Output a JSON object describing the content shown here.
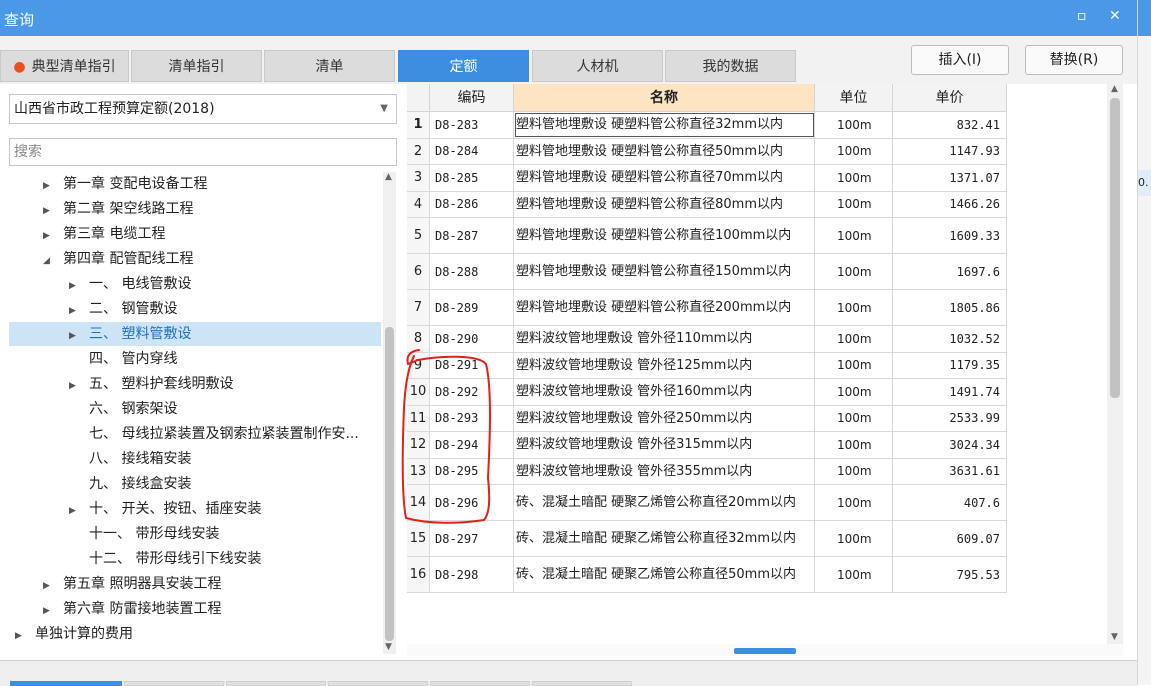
{
  "window": {
    "title": "查询",
    "minimize_glyph": "▫",
    "close_glyph": "✕"
  },
  "tabs": [
    {
      "label": "典型清单指引",
      "icon": "fire-icon"
    },
    {
      "label": "清单指引"
    },
    {
      "label": "清单"
    },
    {
      "label": "定额",
      "active": true
    },
    {
      "label": "人材机"
    },
    {
      "label": "我的数据"
    }
  ],
  "buttons": {
    "insert": "插入(I)",
    "replace": "替换(R)"
  },
  "left": {
    "dropdown_value": "山西省市政工程预算定额(2018)",
    "search_placeholder": "搜索",
    "tree": [
      {
        "label": "第一章 变配电设备工程",
        "arrow": "▶",
        "level": 1
      },
      {
        "label": "第二章 架空线路工程",
        "arrow": "▶",
        "level": 1
      },
      {
        "label": "第三章 电缆工程",
        "arrow": "▶",
        "level": 1
      },
      {
        "label": "第四章 配管配线工程",
        "arrow": "◢",
        "level": 1
      },
      {
        "label": "一、 电线管敷设",
        "arrow": "▶",
        "level": 2
      },
      {
        "label": "二、 钢管敷设",
        "arrow": "▶",
        "level": 2
      },
      {
        "label": "三、 塑料管敷设",
        "arrow": "▶",
        "level": 2,
        "selected": true
      },
      {
        "label": "四、 管内穿线",
        "arrow": "",
        "level": 2
      },
      {
        "label": "五、 塑料护套线明敷设",
        "arrow": "▶",
        "level": 2
      },
      {
        "label": "六、 钢索架设",
        "arrow": "",
        "level": 2
      },
      {
        "label": "七、 母线拉紧装置及钢索拉紧装置制作安...",
        "arrow": "",
        "level": 2
      },
      {
        "label": "八、 接线箱安装",
        "arrow": "",
        "level": 2
      },
      {
        "label": "九、 接线盒安装",
        "arrow": "",
        "level": 2
      },
      {
        "label": "十、 开关、按钮、插座安装",
        "arrow": "▶",
        "level": 2
      },
      {
        "label": "十一、 带形母线安装",
        "arrow": "",
        "level": 2
      },
      {
        "label": "十二、 带形母线引下线安装",
        "arrow": "",
        "level": 2
      },
      {
        "label": "第五章 照明器具安装工程",
        "arrow": "▶",
        "level": 1
      },
      {
        "label": "第六章 防雷接地装置工程",
        "arrow": "▶",
        "level": 1
      },
      {
        "label": "单独计算的费用",
        "arrow": "▶",
        "level": 0
      }
    ]
  },
  "table": {
    "headers": {
      "code": "编码",
      "name": "名称",
      "unit": "单位",
      "price": "单价"
    },
    "rows": [
      {
        "idx": "1",
        "code": "D8-283",
        "name": "塑料管地埋敷设 硬塑料管公称直径32mm以内",
        "unit": "100m",
        "price": "832.41"
      },
      {
        "idx": "2",
        "code": "D8-284",
        "name": "塑料管地埋敷设 硬塑料管公称直径50mm以内",
        "unit": "100m",
        "price": "1147.93"
      },
      {
        "idx": "3",
        "code": "D8-285",
        "name": "塑料管地埋敷设 硬塑料管公称直径70mm以内",
        "unit": "100m",
        "price": "1371.07"
      },
      {
        "idx": "4",
        "code": "D8-286",
        "name": "塑料管地埋敷设 硬塑料管公称直径80mm以内",
        "unit": "100m",
        "price": "1466.26"
      },
      {
        "idx": "5",
        "code": "D8-287",
        "name": "塑料管地埋敷设 硬塑料管公称直径100mm以内",
        "unit": "100m",
        "price": "1609.33"
      },
      {
        "idx": "6",
        "code": "D8-288",
        "name": "塑料管地埋敷设 硬塑料管公称直径150mm以内",
        "unit": "100m",
        "price": "1697.6"
      },
      {
        "idx": "7",
        "code": "D8-289",
        "name": "塑料管地埋敷设 硬塑料管公称直径200mm以内",
        "unit": "100m",
        "price": "1805.86"
      },
      {
        "idx": "8",
        "code": "D8-290",
        "name": "塑料波纹管地埋敷设 管外径110mm以内",
        "unit": "100m",
        "price": "1032.52"
      },
      {
        "idx": "9",
        "code": "D8-291",
        "name": "塑料波纹管地埋敷设 管外径125mm以内",
        "unit": "100m",
        "price": "1179.35"
      },
      {
        "idx": "10",
        "code": "D8-292",
        "name": "塑料波纹管地埋敷设 管外径160mm以内",
        "unit": "100m",
        "price": "1491.74"
      },
      {
        "idx": "11",
        "code": "D8-293",
        "name": "塑料波纹管地埋敷设 管外径250mm以内",
        "unit": "100m",
        "price": "2533.99"
      },
      {
        "idx": "12",
        "code": "D8-294",
        "name": "塑料波纹管地埋敷设 管外径315mm以内",
        "unit": "100m",
        "price": "3024.34"
      },
      {
        "idx": "13",
        "code": "D8-295",
        "name": "塑料波纹管地埋敷设 管外径355mm以内",
        "unit": "100m",
        "price": "3631.61"
      },
      {
        "idx": "14",
        "code": "D8-296",
        "name": "砖、混凝土暗配 硬聚乙烯管公称直径20mm以内",
        "unit": "100m",
        "price": "407.6"
      },
      {
        "idx": "15",
        "code": "D8-297",
        "name": "砖、混凝土暗配 硬聚乙烯管公称直径32mm以内",
        "unit": "100m",
        "price": "609.07"
      },
      {
        "idx": "16",
        "code": "D8-298",
        "name": "砖、混凝土暗配 硬聚乙烯管公称直径50mm以内",
        "unit": "100m",
        "price": "795.53"
      }
    ]
  },
  "right_edge_fragment": "0.",
  "colors": {
    "titlebar": "#4a98e6",
    "active_tab": "#3c8fe0",
    "annotation": "#e0201a"
  }
}
